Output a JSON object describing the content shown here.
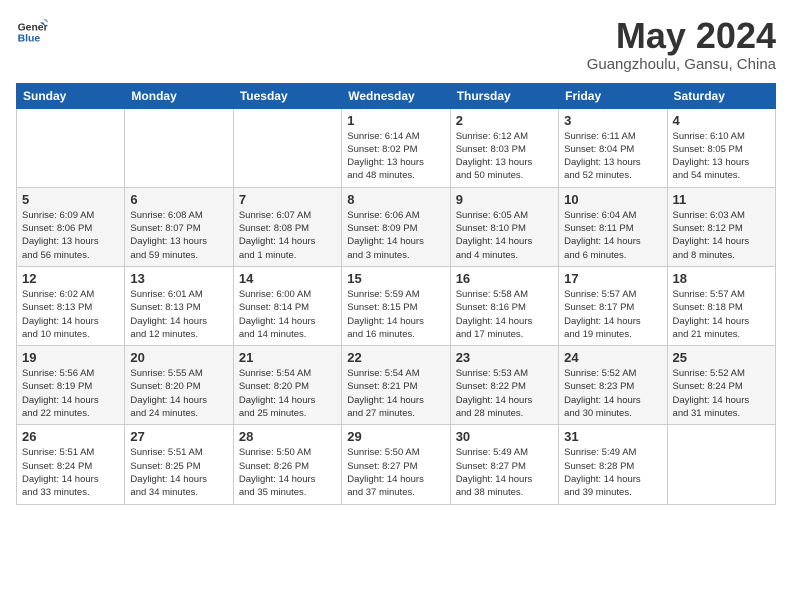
{
  "header": {
    "logo_line1": "General",
    "logo_line2": "Blue",
    "month_title": "May 2024",
    "subtitle": "Guangzhoulu, Gansu, China"
  },
  "weekdays": [
    "Sunday",
    "Monday",
    "Tuesday",
    "Wednesday",
    "Thursday",
    "Friday",
    "Saturday"
  ],
  "weeks": [
    [
      {
        "day": "",
        "info": ""
      },
      {
        "day": "",
        "info": ""
      },
      {
        "day": "",
        "info": ""
      },
      {
        "day": "1",
        "info": "Sunrise: 6:14 AM\nSunset: 8:02 PM\nDaylight: 13 hours\nand 48 minutes."
      },
      {
        "day": "2",
        "info": "Sunrise: 6:12 AM\nSunset: 8:03 PM\nDaylight: 13 hours\nand 50 minutes."
      },
      {
        "day": "3",
        "info": "Sunrise: 6:11 AM\nSunset: 8:04 PM\nDaylight: 13 hours\nand 52 minutes."
      },
      {
        "day": "4",
        "info": "Sunrise: 6:10 AM\nSunset: 8:05 PM\nDaylight: 13 hours\nand 54 minutes."
      }
    ],
    [
      {
        "day": "5",
        "info": "Sunrise: 6:09 AM\nSunset: 8:06 PM\nDaylight: 13 hours\nand 56 minutes."
      },
      {
        "day": "6",
        "info": "Sunrise: 6:08 AM\nSunset: 8:07 PM\nDaylight: 13 hours\nand 59 minutes."
      },
      {
        "day": "7",
        "info": "Sunrise: 6:07 AM\nSunset: 8:08 PM\nDaylight: 14 hours\nand 1 minute."
      },
      {
        "day": "8",
        "info": "Sunrise: 6:06 AM\nSunset: 8:09 PM\nDaylight: 14 hours\nand 3 minutes."
      },
      {
        "day": "9",
        "info": "Sunrise: 6:05 AM\nSunset: 8:10 PM\nDaylight: 14 hours\nand 4 minutes."
      },
      {
        "day": "10",
        "info": "Sunrise: 6:04 AM\nSunset: 8:11 PM\nDaylight: 14 hours\nand 6 minutes."
      },
      {
        "day": "11",
        "info": "Sunrise: 6:03 AM\nSunset: 8:12 PM\nDaylight: 14 hours\nand 8 minutes."
      }
    ],
    [
      {
        "day": "12",
        "info": "Sunrise: 6:02 AM\nSunset: 8:13 PM\nDaylight: 14 hours\nand 10 minutes."
      },
      {
        "day": "13",
        "info": "Sunrise: 6:01 AM\nSunset: 8:13 PM\nDaylight: 14 hours\nand 12 minutes."
      },
      {
        "day": "14",
        "info": "Sunrise: 6:00 AM\nSunset: 8:14 PM\nDaylight: 14 hours\nand 14 minutes."
      },
      {
        "day": "15",
        "info": "Sunrise: 5:59 AM\nSunset: 8:15 PM\nDaylight: 14 hours\nand 16 minutes."
      },
      {
        "day": "16",
        "info": "Sunrise: 5:58 AM\nSunset: 8:16 PM\nDaylight: 14 hours\nand 17 minutes."
      },
      {
        "day": "17",
        "info": "Sunrise: 5:57 AM\nSunset: 8:17 PM\nDaylight: 14 hours\nand 19 minutes."
      },
      {
        "day": "18",
        "info": "Sunrise: 5:57 AM\nSunset: 8:18 PM\nDaylight: 14 hours\nand 21 minutes."
      }
    ],
    [
      {
        "day": "19",
        "info": "Sunrise: 5:56 AM\nSunset: 8:19 PM\nDaylight: 14 hours\nand 22 minutes."
      },
      {
        "day": "20",
        "info": "Sunrise: 5:55 AM\nSunset: 8:20 PM\nDaylight: 14 hours\nand 24 minutes."
      },
      {
        "day": "21",
        "info": "Sunrise: 5:54 AM\nSunset: 8:20 PM\nDaylight: 14 hours\nand 25 minutes."
      },
      {
        "day": "22",
        "info": "Sunrise: 5:54 AM\nSunset: 8:21 PM\nDaylight: 14 hours\nand 27 minutes."
      },
      {
        "day": "23",
        "info": "Sunrise: 5:53 AM\nSunset: 8:22 PM\nDaylight: 14 hours\nand 28 minutes."
      },
      {
        "day": "24",
        "info": "Sunrise: 5:52 AM\nSunset: 8:23 PM\nDaylight: 14 hours\nand 30 minutes."
      },
      {
        "day": "25",
        "info": "Sunrise: 5:52 AM\nSunset: 8:24 PM\nDaylight: 14 hours\nand 31 minutes."
      }
    ],
    [
      {
        "day": "26",
        "info": "Sunrise: 5:51 AM\nSunset: 8:24 PM\nDaylight: 14 hours\nand 33 minutes."
      },
      {
        "day": "27",
        "info": "Sunrise: 5:51 AM\nSunset: 8:25 PM\nDaylight: 14 hours\nand 34 minutes."
      },
      {
        "day": "28",
        "info": "Sunrise: 5:50 AM\nSunset: 8:26 PM\nDaylight: 14 hours\nand 35 minutes."
      },
      {
        "day": "29",
        "info": "Sunrise: 5:50 AM\nSunset: 8:27 PM\nDaylight: 14 hours\nand 37 minutes."
      },
      {
        "day": "30",
        "info": "Sunrise: 5:49 AM\nSunset: 8:27 PM\nDaylight: 14 hours\nand 38 minutes."
      },
      {
        "day": "31",
        "info": "Sunrise: 5:49 AM\nSunset: 8:28 PM\nDaylight: 14 hours\nand 39 minutes."
      },
      {
        "day": "",
        "info": ""
      }
    ]
  ]
}
